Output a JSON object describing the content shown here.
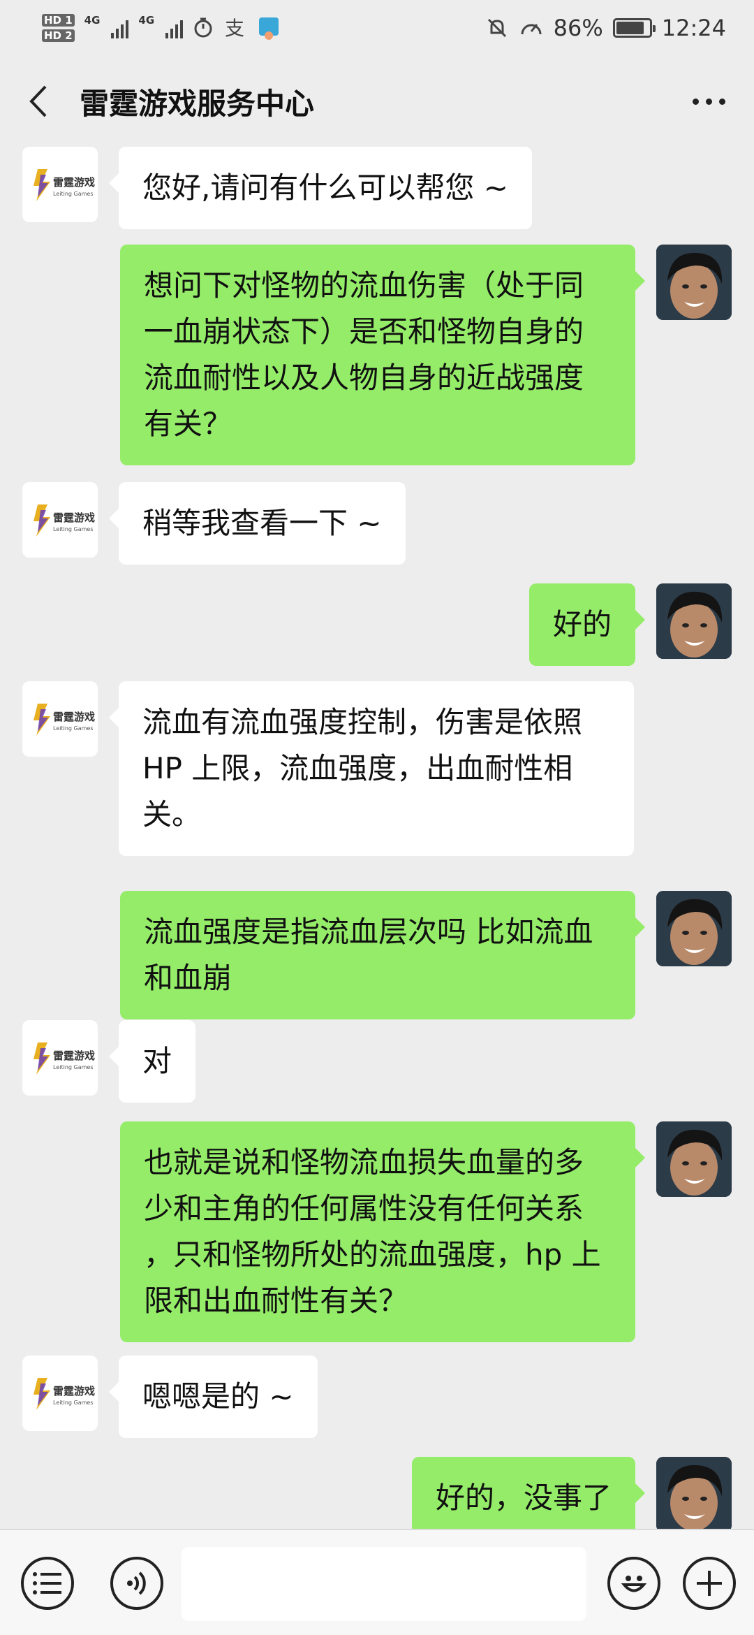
{
  "status_bar": {
    "hd1": "HD 1",
    "hd2": "HD 2",
    "net1": "4G",
    "net2": "4G",
    "battery_text": "86%",
    "battery_level": 0.86,
    "time": "12:24"
  },
  "header": {
    "title": "雷霆游戏服务中心"
  },
  "logo": {
    "brand_cn": "雷霆游戏",
    "brand_en": "Leiting Games"
  },
  "messages": [
    {
      "side": "left",
      "text": "您好,请问有什么可以帮您 ~"
    },
    {
      "side": "right",
      "text": "想问下对怪物的流血伤害（处于同一血崩状态下）是否和怪物自身的流血耐性以及人物自身的近战强度有关？"
    },
    {
      "side": "left",
      "text": "稍等我查看一下 ~"
    },
    {
      "side": "right",
      "text": "好的"
    },
    {
      "side": "left",
      "text": "流血有流血强度控制，伤害是依照 HP 上限，流血强度，出血耐性相关。"
    },
    {
      "side": "right",
      "text": "流血强度是指流血层次吗 比如流血和血崩"
    },
    {
      "side": "left",
      "text": "对"
    },
    {
      "side": "right",
      "text": "也就是说和怪物流血损失血量的多少和主角的任何属性没有任何关系 ，只和怪物所处的流血强度，hp 上限和出血耐性有关？"
    },
    {
      "side": "left",
      "text": "嗯嗯是的 ~"
    },
    {
      "side": "right",
      "text": "好的，没事了"
    }
  ],
  "input": {
    "value": "",
    "placeholder": ""
  },
  "icons": {
    "menu": "list-menu-icon",
    "voice": "voice-icon",
    "emoji": "emoji-icon",
    "plus": "plus-icon"
  },
  "colors": {
    "background": "#ededed",
    "sent_bubble": "#95ec69",
    "received_bubble": "#ffffff"
  }
}
